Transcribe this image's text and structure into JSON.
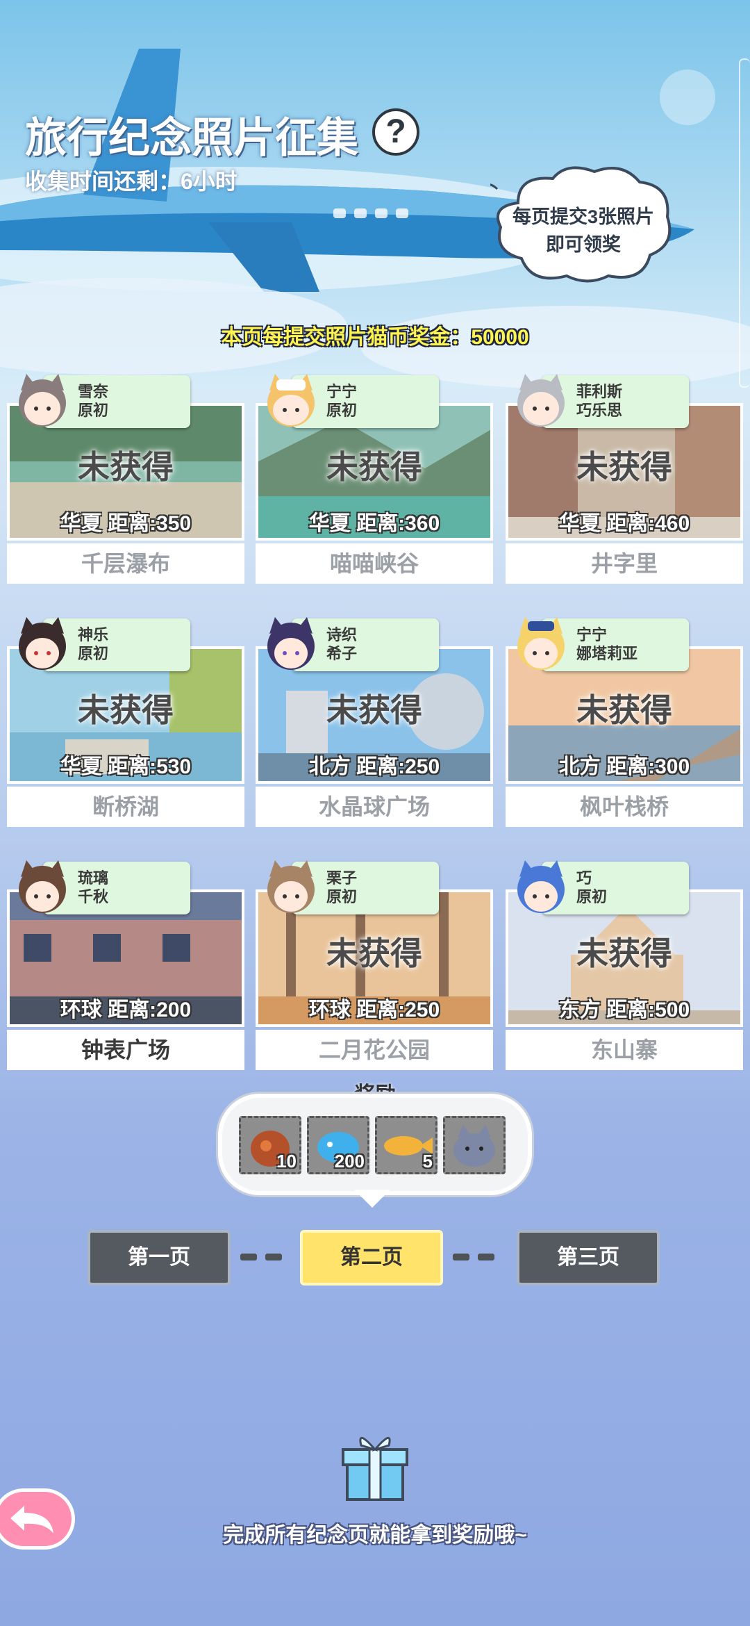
{
  "header": {
    "title": "旅行纪念照片征集",
    "help_label": "?",
    "countdown": "收集时间还剩：6小时"
  },
  "bubble": {
    "line1": "每页提交3张照片",
    "line2": "即可领奖"
  },
  "bonus_text": "本页每提交照片猫币奖金：50000",
  "cards": [
    {
      "char1": "雪奈",
      "char2": "原初",
      "status": "未获得",
      "distance": "华夏  距离:350",
      "place": "千层瀑布",
      "obtained": false
    },
    {
      "char1": "宁宁",
      "char2": "原初",
      "status": "未获得",
      "distance": "华夏  距离:360",
      "place": "喵喵峡谷",
      "obtained": false
    },
    {
      "char1": "菲利斯",
      "char2": "巧乐思",
      "status": "未获得",
      "distance": "华夏  距离:460",
      "place": "井字里",
      "obtained": false
    },
    {
      "char1": "神乐",
      "char2": "原初",
      "status": "未获得",
      "distance": "华夏  距离:530",
      "place": "断桥湖",
      "obtained": false
    },
    {
      "char1": "诗织",
      "char2": "希子",
      "status": "未获得",
      "distance": "北方  距离:250",
      "place": "水晶球广场",
      "obtained": false
    },
    {
      "char1": "宁宁",
      "char2": "娜塔莉亚",
      "status": "未获得",
      "distance": "北方  距离:300",
      "place": "枫叶栈桥",
      "obtained": false
    },
    {
      "char1": "琉璃",
      "char2": "千秋",
      "status": "",
      "distance": "环球  距离:200",
      "place": "钟表广场",
      "obtained": true
    },
    {
      "char1": "栗子",
      "char2": "原初",
      "status": "未获得",
      "distance": "环球  距离:250",
      "place": "二月花公园",
      "obtained": false
    },
    {
      "char1": "巧",
      "char2": "原初",
      "status": "未获得",
      "distance": "东方  距离:500",
      "place": "东山寨",
      "obtained": false
    }
  ],
  "reward": {
    "label": "奖励",
    "items": [
      {
        "icon": "cat-food-bag-icon",
        "count": "10"
      },
      {
        "icon": "blue-fish-icon",
        "count": "200"
      },
      {
        "icon": "gold-fish-icon",
        "count": "5"
      },
      {
        "icon": "cat-plush-icon",
        "count": ""
      }
    ]
  },
  "pager": {
    "page1": "第一页",
    "page2": "第二页",
    "page3": "第三页",
    "active": 2
  },
  "footer": "完成所有纪念页就能拿到奖励哦~",
  "colors": {
    "active_page": "#ffe36b",
    "inactive_page": "#555a60",
    "bonus": "#fff44f",
    "tag_bg": "#e0f7df"
  }
}
